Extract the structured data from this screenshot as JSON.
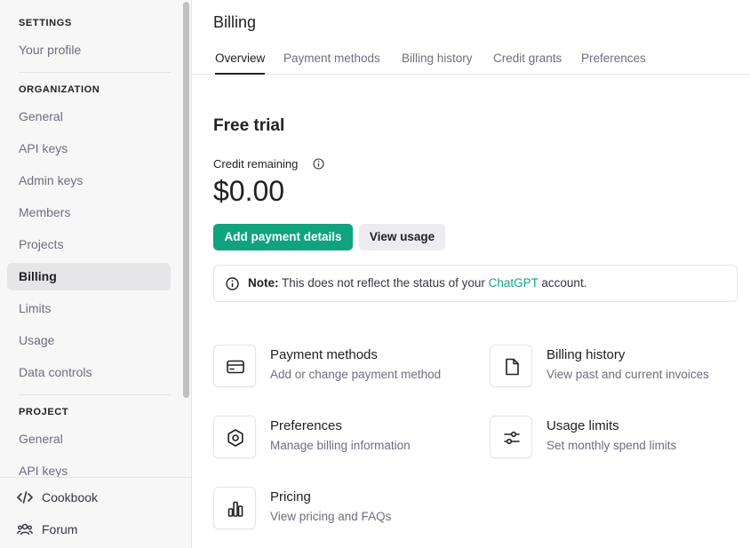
{
  "sidebar": {
    "settings_head": "SETTINGS",
    "your_profile": "Your profile",
    "organization_head": "ORGANIZATION",
    "org_items": [
      "General",
      "API keys",
      "Admin keys",
      "Members",
      "Projects",
      "Billing",
      "Limits",
      "Usage",
      "Data controls"
    ],
    "active_item": "Billing",
    "project_head": "PROJECT",
    "project_items": [
      "General",
      "API keys"
    ],
    "footer": {
      "cookbook": "Cookbook",
      "forum": "Forum"
    }
  },
  "main": {
    "title": "Billing",
    "tabs": [
      "Overview",
      "Payment methods",
      "Billing history",
      "Credit grants",
      "Preferences"
    ],
    "active_tab": "Overview",
    "plan_title": "Free trial",
    "credit_label": "Credit remaining",
    "credit_amount": "$0.00",
    "add_payment_button": "Add payment details",
    "view_usage_button": "View usage",
    "note": {
      "prefix": "Note:",
      "text_before": " This does not reflect the status of your ",
      "link": "ChatGPT",
      "text_after": " account."
    },
    "cards": [
      {
        "title": "Payment methods",
        "desc": "Add or change payment method",
        "icon": "credit-card-icon"
      },
      {
        "title": "Billing history",
        "desc": "View past and current invoices",
        "icon": "document-icon"
      },
      {
        "title": "Preferences",
        "desc": "Manage billing information",
        "icon": "gear-icon"
      },
      {
        "title": "Usage limits",
        "desc": "Set monthly spend limits",
        "icon": "sliders-icon"
      },
      {
        "title": "Pricing",
        "desc": "View pricing and FAQs",
        "icon": "bar-chart-icon"
      }
    ]
  },
  "colors": {
    "accent": "#10a37f",
    "sidebar_bg": "#f7f7f8",
    "active_nav_bg": "#e6e6e9"
  }
}
